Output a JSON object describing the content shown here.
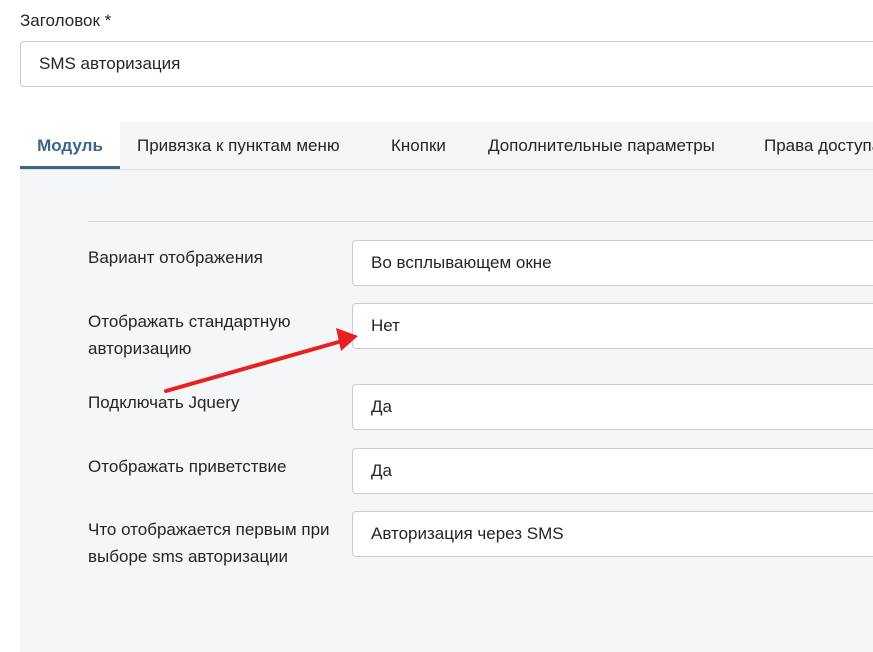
{
  "title_field": {
    "label": "Заголовок *",
    "value": "SMS авторизация"
  },
  "tabs": [
    {
      "label": "Модуль",
      "active": true
    },
    {
      "label": "Привязка к пунктам меню",
      "active": false
    },
    {
      "label": "Кнопки",
      "active": false
    },
    {
      "label": "Дополнительные параметры",
      "active": false
    },
    {
      "label": "Права доступа",
      "active": false
    }
  ],
  "fields": [
    {
      "label": "Вариант отображения",
      "value": "Во всплывающем окне"
    },
    {
      "label": "Отображать стандартную авторизацию",
      "value": "Нет"
    },
    {
      "label": "Подключать Jquery",
      "value": "Да"
    },
    {
      "label": "Отображать приветствие",
      "value": "Да"
    },
    {
      "label": "Что отображается первым при выборе sms авторизации",
      "value": "Авторизация через SMS"
    }
  ],
  "colors": {
    "accent": "#3d6585",
    "annotation_arrow": "#e8201f"
  }
}
